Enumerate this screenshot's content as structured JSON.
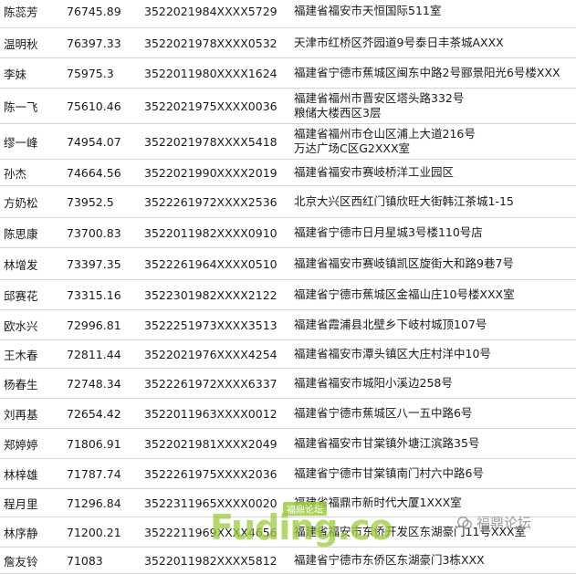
{
  "rows": [
    {
      "name": "陈蕊芳",
      "amount": "76745.89",
      "id": "3522021984XXXX5729",
      "address": [
        "福建省福安市天恒国际511室"
      ]
    },
    {
      "name": "温明秋",
      "amount": "76397.33",
      "id": "3522021978XXXX0532",
      "address": [
        "天津市红桥区芥园道9号泰日丰茶城AXXX"
      ]
    },
    {
      "name": "李妹",
      "amount": "75975.3",
      "id": "3522011980XXXX1624",
      "address": [
        "福建省宁德市蕉城区闽东中路2号郦景阳光6号楼XXX"
      ]
    },
    {
      "name": "陈一飞",
      "amount": "75610.46",
      "id": "3522021975XXXX0036",
      "address": [
        "福建省福州市晋安区塔头路332号",
        "粮储大楼西区3层"
      ]
    },
    {
      "name": "缪一峰",
      "amount": "74954.07",
      "id": "3522021978XXXX5418",
      "address": [
        "福建省福州市仓山区浦上大道216号",
        "万达广场C区G2XXX室"
      ]
    },
    {
      "name": "孙杰",
      "amount": "74664.56",
      "id": "3522021990XXXX2019",
      "address": [
        "福建省福安市赛岐桥洋工业园区"
      ]
    },
    {
      "name": "方奶松",
      "amount": "73952.5",
      "id": "3522261972XXXX2536",
      "address": [
        "北京大兴区西红门镇欣旺大街韩江茶城1-15"
      ]
    },
    {
      "name": "陈思康",
      "amount": "73700.83",
      "id": "3522011982XXXX0910",
      "address": [
        "福建省宁德市日月星城3号楼110号店"
      ]
    },
    {
      "name": "林增发",
      "amount": "73397.35",
      "id": "3522261964XXXX0510",
      "address": [
        "福建省福安市赛岐镇凯区旋街大和路9巷7号"
      ]
    },
    {
      "name": "邱赛花",
      "amount": "73315.16",
      "id": "3522301982XXXX2122",
      "address": [
        "福建省宁德市蕉城区金福山庄10号楼XXX室"
      ]
    },
    {
      "name": "欧水兴",
      "amount": "72996.81",
      "id": "3522251973XXXX3513",
      "address": [
        "福建省霞浦县北壁乡下岐村城顶107号"
      ]
    },
    {
      "name": "王木春",
      "amount": "72811.44",
      "id": "3522021976XXXX4254",
      "address": [
        "福建省福安市潭头镇区大庄村洋中10号"
      ]
    },
    {
      "name": "杨春生",
      "amount": "72748.34",
      "id": "3522261972XXXX6337",
      "address": [
        "福建省福安市城阳小溪边258号"
      ]
    },
    {
      "name": "刘再基",
      "amount": "72654.42",
      "id": "3522011963XXXX0012",
      "address": [
        "福建省宁德市蕉城区八一五中路6号"
      ]
    },
    {
      "name": "郑婷婷",
      "amount": "71806.91",
      "id": "3522021981XXXX2049",
      "address": [
        "福建省福安市甘棠镇外塘江滨路35号"
      ]
    },
    {
      "name": "林梓雄",
      "amount": "71787.74",
      "id": "3522261975XXXX2036",
      "address": [
        "福建省宁德市甘棠镇南门村六中路6号"
      ]
    },
    {
      "name": "程月里",
      "amount": "71296.84",
      "id": "3522311965XXXX0020",
      "address": [
        "福建省福鼎市新时代大厦1XXX室"
      ]
    },
    {
      "name": "林序静",
      "amount": "71200.21",
      "id": "3522211969XXXX4656",
      "address": [
        "福建省福安市东侨开发区东湖豪门11号XXX室"
      ]
    },
    {
      "name": "詹友铃",
      "amount": "71083",
      "id": "3522011982XXXX5812",
      "address": [
        "福建省宁德市东侨区东湖豪门3栋XXX"
      ]
    }
  ],
  "watermark": {
    "site": "Fuding.co",
    "tag": "福鼎论坛",
    "forum": "福鼎论坛"
  }
}
